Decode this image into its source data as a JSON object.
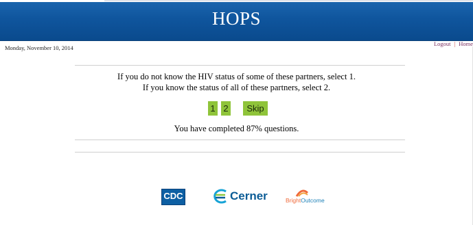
{
  "header": {
    "title": "HOPS"
  },
  "date": "Monday, November 10, 2014",
  "links": {
    "logout": "Logout",
    "separator": "|",
    "home": "Home"
  },
  "question": {
    "line1": "If you do not know the HIV status of some of these partners, select 1.",
    "line2": "If you know the status of all of these partners, select 2."
  },
  "buttons": {
    "option1": "1",
    "option2": "2",
    "skip": "Skip"
  },
  "progress": {
    "text": "You have completed 87% questions.",
    "percent": 87
  },
  "logos": {
    "cdc": "CDC",
    "cerner": "Cerner",
    "brightoutcome_bright": "Bright",
    "brightoutcome_outcome": "Outcome"
  },
  "colors": {
    "header": "#0f559d",
    "button": "#8fc43a",
    "link": "#7a2f61"
  }
}
